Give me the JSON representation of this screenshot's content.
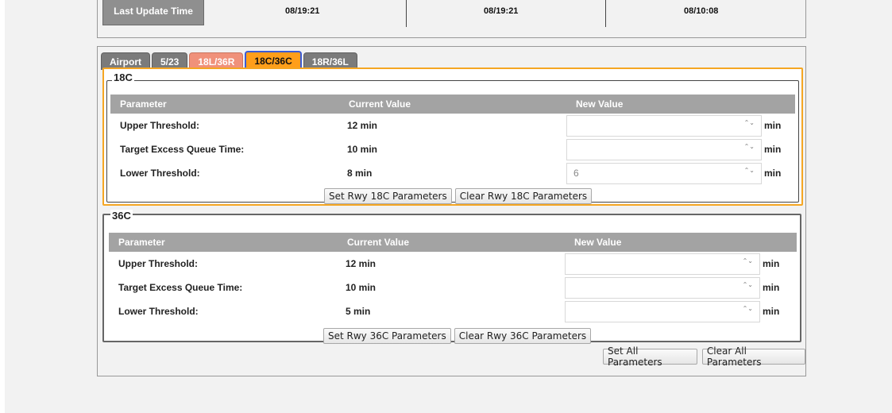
{
  "status": {
    "last_update_label": "Last Update Time",
    "times": [
      "08/19:21",
      "08/19:21",
      "08/10:08"
    ]
  },
  "tabs": [
    {
      "label": "Airport",
      "style": "gray"
    },
    {
      "label": "5/23",
      "style": "gray"
    },
    {
      "label": "18L/36R",
      "style": "salmon"
    },
    {
      "label": "18C/36C",
      "style": "active"
    },
    {
      "label": "18R/36L",
      "style": "gray"
    }
  ],
  "colors": {
    "active_tab": "#ff9e1a",
    "salmon_tab": "#f0917a",
    "highlight_border": "#f5a623",
    "table_header": "#a3a3a3"
  },
  "headers": {
    "parameter": "Parameter",
    "current": "Current Value",
    "new": "New Value"
  },
  "runways": [
    {
      "name": "18C",
      "rows": [
        {
          "param": "Upper Threshold:",
          "current": "12 min",
          "new_value": "",
          "unit": "min"
        },
        {
          "param": "Target Excess Queue Time:",
          "current": "10 min",
          "new_value": "",
          "unit": "min"
        },
        {
          "param": "Lower Threshold:",
          "current": "8 min",
          "new_value": "6",
          "unit": "min"
        }
      ],
      "set_label": "Set Rwy 18C Parameters",
      "clear_label": "Clear Rwy 18C Parameters"
    },
    {
      "name": "36C",
      "rows": [
        {
          "param": "Upper Threshold:",
          "current": "12 min",
          "new_value": "",
          "unit": "min"
        },
        {
          "param": "Target Excess Queue Time:",
          "current": "10 min",
          "new_value": "",
          "unit": "min"
        },
        {
          "param": "Lower Threshold:",
          "current": "5 min",
          "new_value": "",
          "unit": "min"
        }
      ],
      "set_label": "Set Rwy 36C Parameters",
      "clear_label": "Clear Rwy 36C Parameters"
    }
  ],
  "global": {
    "set_all": "Set All Parameters",
    "clear_all": "Clear All Parameters"
  },
  "spinner_glyph": "⌃⌄"
}
